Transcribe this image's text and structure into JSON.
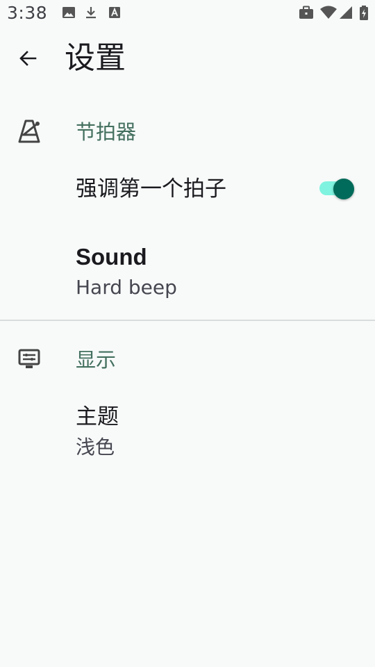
{
  "status_bar": {
    "time": "3:38",
    "left_icons": [
      "image-icon",
      "download-icon",
      "font-icon"
    ],
    "right_icons": [
      "briefcase-icon",
      "wifi-icon",
      "signal-icon",
      "battery-charging-icon"
    ]
  },
  "toolbar": {
    "back_icon": "arrow-back-icon",
    "title": "设置"
  },
  "categories": [
    {
      "icon": "metronome-icon",
      "title": "节拍器",
      "preferences": [
        {
          "title": "强调第一个拍子",
          "type": "switch",
          "checked": true
        },
        {
          "title": "Sound",
          "summary": "Hard beep",
          "type": "list"
        }
      ]
    },
    {
      "icon": "display-settings-icon",
      "title": "显示",
      "preferences": [
        {
          "title": "主题",
          "summary": "浅色",
          "type": "list"
        }
      ]
    }
  ],
  "colors": {
    "background": "#f8fafa",
    "category_title": "#44705f",
    "switch_thumb": "#006b5a",
    "switch_track": "#7ff3df"
  }
}
